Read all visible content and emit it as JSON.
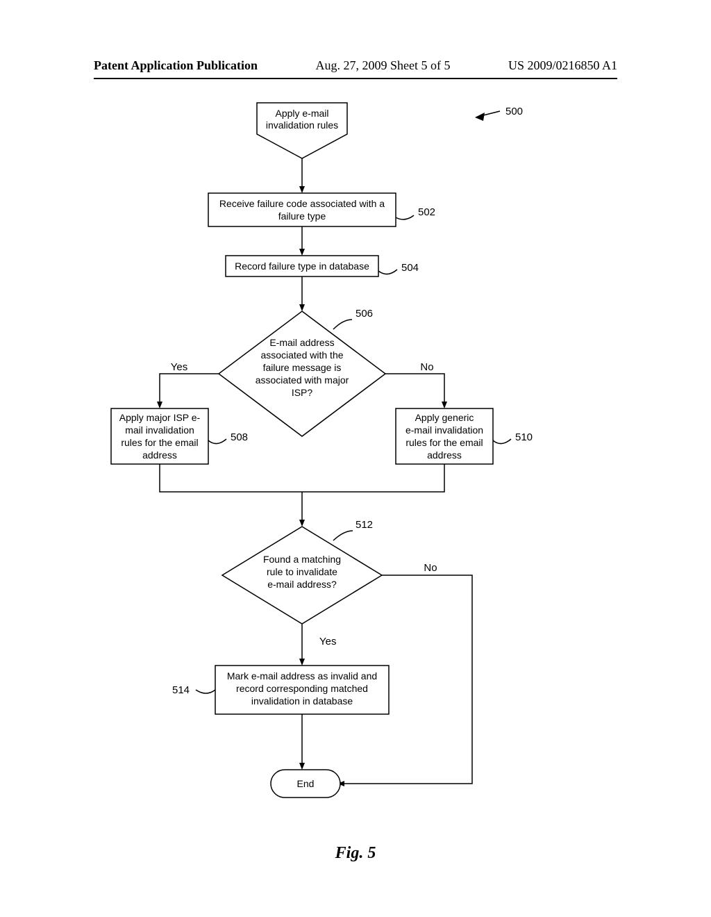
{
  "header": {
    "left": "Patent Application Publication",
    "middle": "Aug. 27, 2009  Sheet 5 of 5",
    "right": "US 2009/0216850 A1"
  },
  "refs": {
    "r500": "500",
    "r502": "502",
    "r504": "504",
    "r506": "506",
    "r508": "508",
    "r510": "510",
    "r512": "512",
    "r514": "514"
  },
  "labels": {
    "yes506": "Yes",
    "no506": "No",
    "yes512": "Yes",
    "no512": "No",
    "end": "End"
  },
  "nodes": {
    "start_l1": "Apply e-mail",
    "start_l2": "invalidation rules",
    "n502_l1": "Receive failure code associated with a",
    "n502_l2": "failure type",
    "n504": "Record failure type in database",
    "d506_l1": "E-mail address",
    "d506_l2": "associated with the",
    "d506_l3": "failure message is",
    "d506_l4": "associated with major",
    "d506_l5": "ISP?",
    "n508_l1": "Apply major ISP e-",
    "n508_l2": "mail invalidation",
    "n508_l3": "rules for the email",
    "n508_l4": "address",
    "n510_l1": "Apply generic",
    "n510_l2": "e-mail invalidation",
    "n510_l3": "rules for the email",
    "n510_l4": "address",
    "d512_l1": "Found a matching",
    "d512_l2": "rule to invalidate",
    "d512_l3": "e-mail address?",
    "n514_l1": "Mark e-mail address as invalid and",
    "n514_l2": "record corresponding matched",
    "n514_l3": "invalidation in database"
  },
  "figcaption": "Fig. 5"
}
